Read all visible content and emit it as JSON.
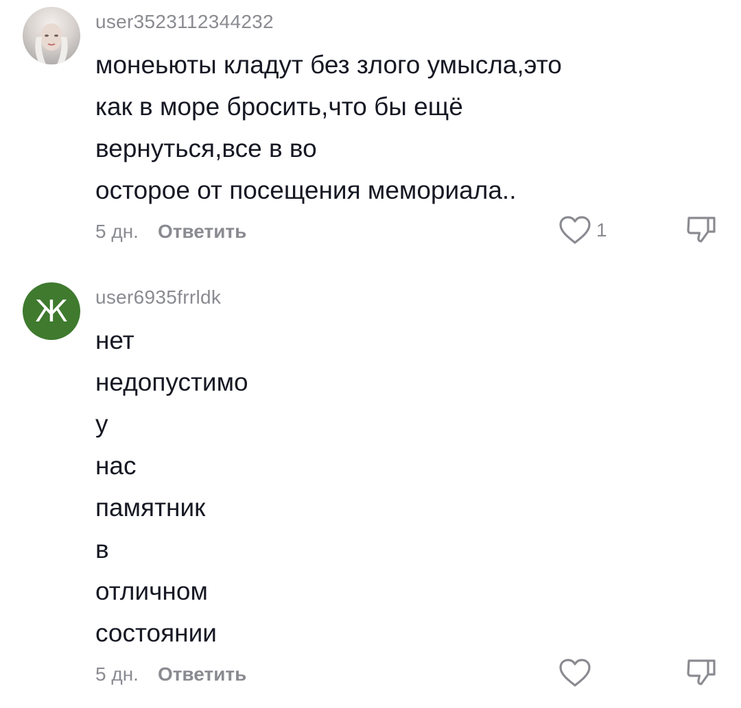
{
  "comments": [
    {
      "avatar_icon": "user-photo-avatar",
      "username": "user3523112344232",
      "lines": [
        "монеьюты кладут без злого умысла,это",
        "как в море бросить,что бы ещё",
        "вернуться,все в во",
        "осторое от посещения мемориала.."
      ],
      "time": "5 дн.",
      "reply_label": "Ответить",
      "like_count": "1"
    },
    {
      "avatar_letter": "Ж",
      "avatar_color": "#3f7a2e",
      "username": "user6935frrldk",
      "lines": [
        "нет",
        "недопустимо",
        "у",
        "нас",
        "памятник",
        "в",
        "отличном",
        "состоянии"
      ],
      "time": "5 дн.",
      "reply_label": "Ответить",
      "like_count": ""
    }
  ],
  "icons": {
    "like": "heart-outline-icon",
    "dislike": "thumbs-down-icon"
  },
  "colors": {
    "text": "#161823",
    "secondary": "#8a8b91"
  }
}
